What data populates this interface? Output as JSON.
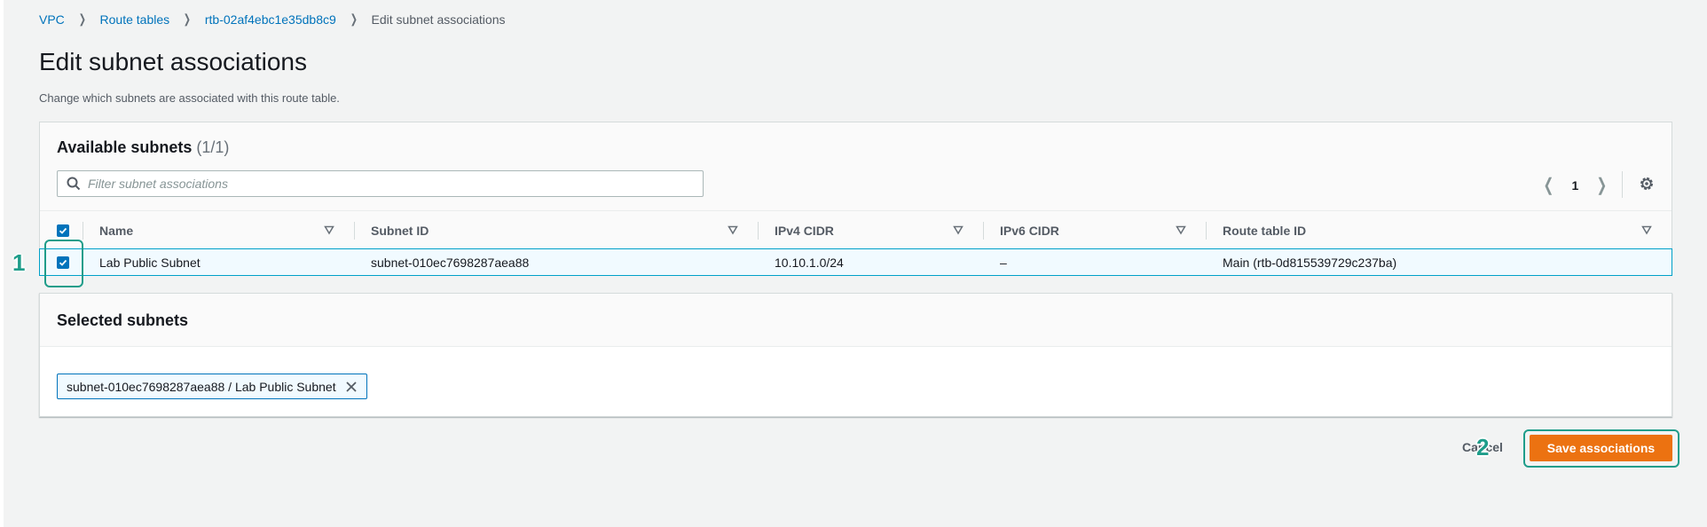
{
  "breadcrumb": {
    "items": [
      "VPC",
      "Route tables",
      "rtb-02af4ebc1e35db8c9"
    ],
    "current": "Edit subnet associations"
  },
  "page": {
    "title": "Edit subnet associations",
    "description": "Change which subnets are associated with this route table."
  },
  "available": {
    "title": "Available subnets",
    "count": "(1/1)",
    "filter_placeholder": "Filter subnet associations",
    "page": "1",
    "columns": [
      "Name",
      "Subnet ID",
      "IPv4 CIDR",
      "IPv6 CIDR",
      "Route table ID"
    ],
    "rows": [
      {
        "name": "Lab Public Subnet",
        "subnet_id": "subnet-010ec7698287aea88",
        "ipv4": "10.10.1.0/24",
        "ipv6": "–",
        "route_table": "Main (rtb-0d815539729c237ba)",
        "checked": true
      }
    ]
  },
  "selected": {
    "title": "Selected subnets",
    "tokens": [
      "subnet-010ec7698287aea88 / Lab Public Subnet"
    ]
  },
  "actions": {
    "cancel": "Cancel",
    "save": "Save associations"
  },
  "annotations": {
    "step1": "1",
    "step2": "2",
    "color": "#1f9d8a"
  },
  "colors": {
    "primary": "#ec7211",
    "link": "#0073bb"
  }
}
